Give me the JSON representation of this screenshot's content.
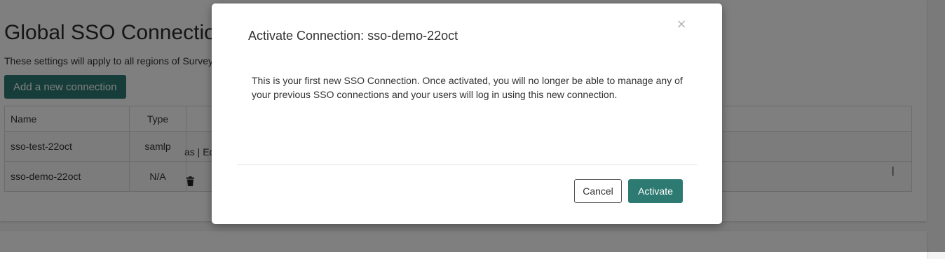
{
  "page": {
    "title": "Global SSO Connections",
    "subtitle": "These settings will apply to all regions of SurveyMonkey.",
    "add_button": "Add a new connection"
  },
  "table": {
    "headers": [
      "Name",
      "Type",
      ""
    ],
    "rows": [
      {
        "name": "sso-test-22oct",
        "type": "samlp",
        "actions": "as | Edit connection"
      },
      {
        "name": "sso-demo-22oct",
        "type": "N/A",
        "actions": "|"
      }
    ]
  },
  "modal": {
    "title": "Activate Connection: sso-demo-22oct",
    "close": "×",
    "body": "This is your first new SSO Connection. Once activated, you will no longer be able to manage any of your previous SSO connections and your users will log in using this new connection.",
    "cancel_label": "Cancel",
    "activate_label": "Activate"
  },
  "colors": {
    "primary": "#2d7a72",
    "backdrop": "rgba(0,0,0,0.5)"
  },
  "icons": [
    "close-icon",
    "trash-icon"
  ]
}
